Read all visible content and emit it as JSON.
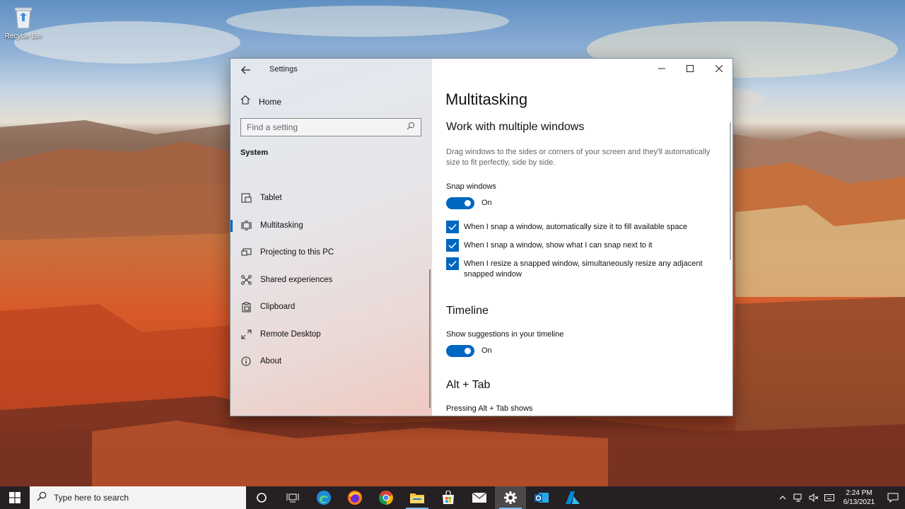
{
  "desktop": {
    "recycle_bin_label": "Recycle Bin"
  },
  "window": {
    "title": "Settings",
    "controls": [
      "minimize",
      "maximize",
      "close"
    ]
  },
  "sidebar": {
    "home_label": "Home",
    "search_placeholder": "Find a setting",
    "section_label": "System",
    "items": [
      {
        "label": "Tablet",
        "icon": "tablet-icon"
      },
      {
        "label": "Multitasking",
        "icon": "multitasking-icon",
        "active": true
      },
      {
        "label": "Projecting to this PC",
        "icon": "projecting-icon"
      },
      {
        "label": "Shared experiences",
        "icon": "shared-experiences-icon"
      },
      {
        "label": "Clipboard",
        "icon": "clipboard-icon"
      },
      {
        "label": "Remote Desktop",
        "icon": "remote-desktop-icon"
      },
      {
        "label": "About",
        "icon": "info-icon"
      }
    ]
  },
  "main": {
    "title": "Multitasking",
    "work_heading": "Work with multiple windows",
    "work_description": "Drag windows to the sides or corners of your screen and they'll automatically size to fit perfectly, side by side.",
    "snap_label": "Snap windows",
    "snap_state": "On",
    "checkboxes": [
      {
        "label": "When I snap a window, automatically size it to fill available space",
        "checked": true
      },
      {
        "label": "When I snap a window, show what I can snap next to it",
        "checked": true
      },
      {
        "label": "When I resize a snapped window, simultaneously resize any adjacent snapped window",
        "checked": true
      }
    ],
    "timeline_heading": "Timeline",
    "timeline_label": "Show suggestions in your timeline",
    "timeline_state": "On",
    "alttab_heading": "Alt + Tab",
    "alttab_label": "Pressing Alt + Tab shows"
  },
  "taskbar": {
    "search_placeholder": "Type here to search",
    "apps": [
      "cortana",
      "task-view",
      "edge",
      "firefox",
      "chrome",
      "file-explorer",
      "store",
      "mail",
      "settings",
      "outlook",
      "azure"
    ],
    "time": "2:24 PM",
    "date": "6/13/2021"
  },
  "colors": {
    "accent": "#0067c0",
    "taskbar": "#202024"
  }
}
